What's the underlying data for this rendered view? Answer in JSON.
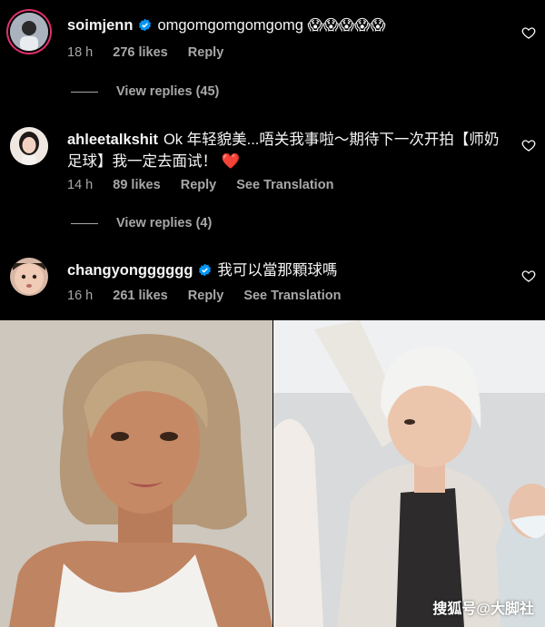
{
  "colors": {
    "background": "#000000",
    "muted": "#a8a8a8",
    "verified": "#0095f6",
    "heart": "#ed2e4d"
  },
  "comments": [
    {
      "username": "soimjenn",
      "verified": true,
      "text": "omgomgomgomgomg 😱😱😱😱😱",
      "time": "18 h",
      "likes": "276 likes",
      "reply": "Reply",
      "view_replies": "View replies (45)"
    },
    {
      "username": "ahleetalkshit",
      "verified": false,
      "text": "Ok 年轻貌美...唔关我事啦～期待下一次开拍【师奶足球】我一定去面试！",
      "emoji": "❤️",
      "time": "14 h",
      "likes": "89 likes",
      "reply": "Reply",
      "translation": "See Translation",
      "view_replies": "View replies (4)"
    },
    {
      "username": "changyongggggg",
      "verified": true,
      "text": "我可以當那顆球嗎",
      "time": "16 h",
      "likes": "261 likes",
      "reply": "Reply",
      "translation": "See Translation"
    }
  ],
  "watermark": "搜狐号@大脚社"
}
